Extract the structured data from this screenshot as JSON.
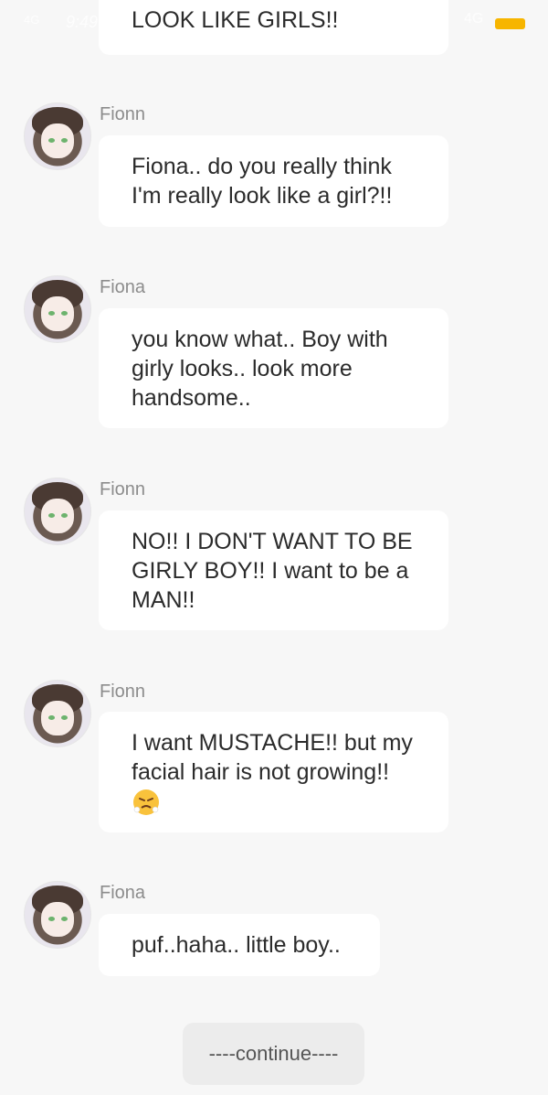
{
  "status_bar": {
    "network": "4G",
    "time": "9:49",
    "lte": "4G"
  },
  "messages": [
    {
      "sender": "",
      "text": "LOOK LIKE GIRLS!!"
    },
    {
      "sender": "Fionn",
      "text": "Fiona.. do you really think I'm really look like a girl?!!"
    },
    {
      "sender": "Fiona",
      "text": "you know what.. Boy with girly looks.. look more handsome.."
    },
    {
      "sender": "Fionn",
      "text": "NO!!  I DON'T WANT TO BE GIRLY BOY!!  I want to be a MAN!!"
    },
    {
      "sender": "Fionn",
      "text": "I want MUSTACHE!! but my facial hair is not growing!!",
      "emoji": "angry-steam-face"
    },
    {
      "sender": "Fiona",
      "text": "puf..haha.. little boy.."
    }
  ],
  "continue_label": "----continue----",
  "colors": {
    "background": "#f7f7f7",
    "bubble": "#ffffff",
    "battery": "#f7b500",
    "name": "#8c8c8c"
  }
}
